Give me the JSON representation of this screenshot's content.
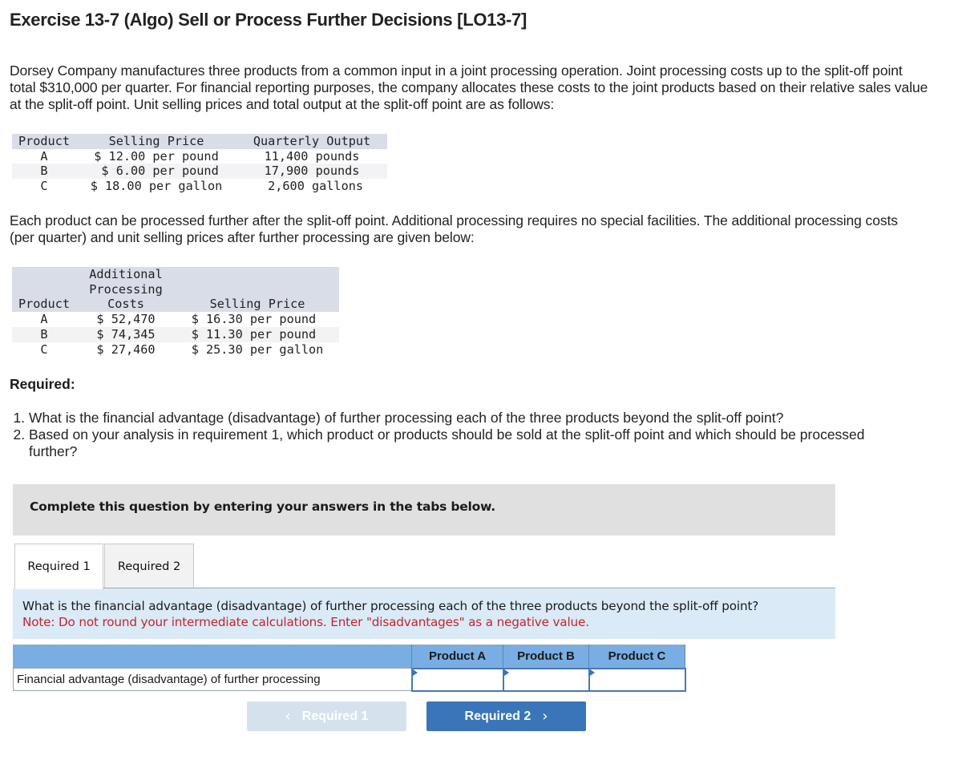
{
  "title": "Exercise 13-7 (Algo) Sell or Process Further Decisions [LO13-7]",
  "intro_paragraph": "Dorsey Company manufactures three products from a common input in a joint processing operation. Joint processing costs up to the split-off point total $310,000 per quarter. For financial reporting purposes, the company allocates these costs to the joint products based on their relative sales value at the split-off point. Unit selling prices and total output at the split-off point are as follows:",
  "splitoff_table": {
    "headers": [
      "Product",
      "Selling Price",
      "Quarterly Output"
    ],
    "rows": [
      [
        "A",
        "$ 12.00 per pound",
        "11,400 pounds"
      ],
      [
        "B",
        " $ 6.00 per pound",
        "17,900 pounds"
      ],
      [
        "C",
        "$ 18.00 per gallon",
        " 2,600 gallons"
      ]
    ]
  },
  "further_paragraph": "Each product can be processed further after the split-off point. Additional processing requires no special facilities. The additional processing costs (per quarter) and unit selling prices after further processing are given below:",
  "further_table": {
    "headers": [
      "Product",
      "Additional\nProcessing\nCosts",
      "Selling Price"
    ],
    "rows": [
      [
        "A",
        "$ 52,470",
        "$ 16.30 per pound "
      ],
      [
        "B",
        "$ 74,345",
        "$ 11.30 per pound "
      ],
      [
        "C",
        "$ 27,460",
        "$ 25.30 per gallon"
      ]
    ]
  },
  "required": {
    "heading": "Required:",
    "items": [
      "What is the financial advantage (disadvantage) of further processing each of the three products beyond the split-off point?",
      "Based on your analysis in requirement 1, which product or products should be sold at the split-off point and which should be processed further?"
    ]
  },
  "instruction_box": "Complete this question by entering your answers in the tabs below.",
  "tabs": [
    {
      "label": "Required 1",
      "active": true
    },
    {
      "label": "Required 2",
      "active": false
    }
  ],
  "question_panel": {
    "question": "What is the financial advantage (disadvantage) of further processing each of the three products beyond the split-off point?",
    "note": "Note: Do not round your intermediate calculations. Enter \"disadvantages\" as a negative value."
  },
  "answer_table": {
    "columns": [
      "Product A",
      "Product B",
      "Product C"
    ],
    "row_label": "Financial advantage (disadvantage) of further processing",
    "values": [
      "",
      "",
      ""
    ]
  },
  "nav": {
    "prev_label": "Required 1",
    "next_label": "Required 2",
    "prev_icon": "chevron-left-icon",
    "next_icon": "chevron-right-icon"
  },
  "colors": {
    "header_blue": "#78aee3",
    "question_bg": "#dbeaf7",
    "note_red": "#c0262d",
    "next_button": "#3a75b9",
    "prev_button_disabled": "#d6e1ee"
  }
}
